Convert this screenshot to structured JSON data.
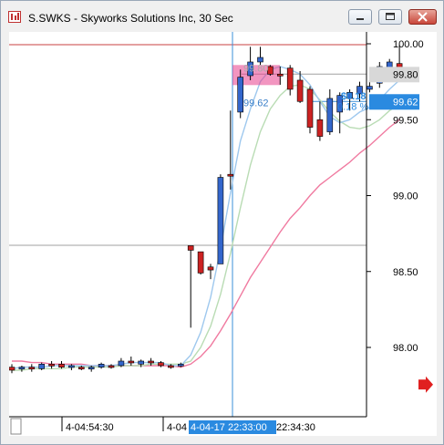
{
  "window": {
    "title": "S.SWKS - Skyworks Solutions Inc, 30 Sec",
    "minimize_icon": "minimize-icon",
    "maximize_icon": "maximize-icon",
    "close_icon": "close-icon"
  },
  "chart_data": {
    "type": "candlestick",
    "symbol": "S.SWKS",
    "y_ticks": [
      "100.00",
      "99.50",
      "99.00",
      "98.50",
      "98.00"
    ],
    "y_tick_values": [
      100.0,
      99.5,
      99.0,
      98.5,
      98.0
    ],
    "ylim": [
      97.55,
      100.07
    ],
    "x_labels": [
      "4-04:54:30",
      "4-04",
      "4-04-17 22:33:00",
      "22:34:30"
    ],
    "last_price_label": "99.80",
    "current_price_label": "99.62",
    "measure": {
      "start_label": "99.80",
      "end_label": "99.62",
      "change_label": "$0.18",
      "change_pct_label": "0.18 %"
    },
    "crosshair_time": "4-04-17 22:33:00",
    "colors": {
      "up": "#3366cc",
      "down": "#cc2222",
      "highlight": "#e83e8c",
      "ma_blue": "#9ec8ee",
      "ma_green": "#b9dcb4",
      "ma_pink": "#f07aa0",
      "resistance": "#c84040"
    },
    "candles": [
      {
        "o": 97.87,
        "h": 97.89,
        "l": 97.83,
        "c": 97.85
      },
      {
        "o": 97.86,
        "h": 97.88,
        "l": 97.84,
        "c": 97.87
      },
      {
        "o": 97.87,
        "h": 97.89,
        "l": 97.84,
        "c": 97.86
      },
      {
        "o": 97.86,
        "h": 97.9,
        "l": 97.85,
        "c": 97.89
      },
      {
        "o": 97.89,
        "h": 97.91,
        "l": 97.86,
        "c": 97.88
      },
      {
        "o": 97.89,
        "h": 97.91,
        "l": 97.86,
        "c": 97.87
      },
      {
        "o": 97.87,
        "h": 97.89,
        "l": 97.85,
        "c": 97.88
      },
      {
        "o": 97.87,
        "h": 97.88,
        "l": 97.85,
        "c": 97.86
      },
      {
        "o": 97.86,
        "h": 97.88,
        "l": 97.84,
        "c": 97.87
      },
      {
        "o": 97.87,
        "h": 97.9,
        "l": 97.86,
        "c": 97.89
      },
      {
        "o": 97.88,
        "h": 97.89,
        "l": 97.86,
        "c": 97.87
      },
      {
        "o": 97.88,
        "h": 97.93,
        "l": 97.87,
        "c": 97.91
      },
      {
        "o": 97.91,
        "h": 97.94,
        "l": 97.88,
        "c": 97.9
      },
      {
        "o": 97.89,
        "h": 97.92,
        "l": 97.87,
        "c": 97.91
      },
      {
        "o": 97.91,
        "h": 97.93,
        "l": 97.88,
        "c": 97.9
      },
      {
        "o": 97.9,
        "h": 97.91,
        "l": 97.87,
        "c": 97.88
      },
      {
        "o": 97.88,
        "h": 97.89,
        "l": 97.86,
        "c": 97.87
      },
      {
        "o": 97.88,
        "h": 97.9,
        "l": 97.87,
        "c": 97.89
      },
      {
        "o": 98.67,
        "h": 98.67,
        "l": 98.13,
        "c": 98.64
      },
      {
        "o": 98.63,
        "h": 98.63,
        "l": 98.48,
        "c": 98.49
      },
      {
        "o": 98.53,
        "h": 98.55,
        "l": 98.45,
        "c": 98.51
      },
      {
        "o": 98.55,
        "h": 99.14,
        "l": 98.55,
        "c": 99.12
      },
      {
        "o": 99.14,
        "h": 99.56,
        "l": 99.04,
        "c": 99.13
      },
      {
        "o": 99.55,
        "h": 99.83,
        "l": 99.51,
        "c": 99.78
      },
      {
        "o": 99.79,
        "h": 99.98,
        "l": 99.76,
        "c": 99.88
      },
      {
        "o": 99.88,
        "h": 99.98,
        "l": 99.86,
        "c": 99.91
      },
      {
        "o": 99.85,
        "h": 99.86,
        "l": 99.79,
        "c": 99.8
      },
      {
        "o": 99.8,
        "h": 99.85,
        "l": 99.73,
        "c": 99.79
      },
      {
        "o": 99.84,
        "h": 99.86,
        "l": 99.66,
        "c": 99.7
      },
      {
        "o": 99.76,
        "h": 99.82,
        "l": 99.61,
        "c": 99.62
      },
      {
        "o": 99.7,
        "h": 99.72,
        "l": 99.41,
        "c": 99.45
      },
      {
        "o": 99.5,
        "h": 99.62,
        "l": 99.36,
        "c": 99.39
      },
      {
        "o": 99.42,
        "h": 99.7,
        "l": 99.4,
        "c": 99.64
      },
      {
        "o": 99.55,
        "h": 99.68,
        "l": 99.41,
        "c": 99.66
      },
      {
        "o": 99.64,
        "h": 99.7,
        "l": 99.56,
        "c": 99.68
      },
      {
        "o": 99.67,
        "h": 99.75,
        "l": 99.62,
        "c": 99.72
      },
      {
        "o": 99.7,
        "h": 99.76,
        "l": 99.68,
        "c": 99.72
      },
      {
        "o": 99.74,
        "h": 99.88,
        "l": 99.71,
        "c": 99.85
      },
      {
        "o": 99.83,
        "h": 99.9,
        "l": 99.79,
        "c": 99.88
      },
      {
        "o": 99.87,
        "h": 99.99,
        "l": 99.75,
        "c": 99.83
      }
    ],
    "ma_blue": [
      97.86,
      97.87,
      97.87,
      97.87,
      97.88,
      97.88,
      97.88,
      97.88,
      97.88,
      97.88,
      97.88,
      97.89,
      97.9,
      97.9,
      97.9,
      97.9,
      97.88,
      97.88,
      97.95,
      98.1,
      98.33,
      98.65,
      99.02,
      99.36,
      99.57,
      99.75,
      99.83,
      99.85,
      99.83,
      99.8,
      99.73,
      99.62,
      99.52,
      99.48,
      99.5,
      99.55,
      99.58,
      99.63,
      99.7,
      99.76
    ],
    "ma_green": [
      97.85,
      97.85,
      97.86,
      97.86,
      97.86,
      97.86,
      97.87,
      97.87,
      97.87,
      97.87,
      97.87,
      97.88,
      97.88,
      97.88,
      97.89,
      97.89,
      97.89,
      97.89,
      97.91,
      98.0,
      98.14,
      98.35,
      98.62,
      98.92,
      99.2,
      99.42,
      99.57,
      99.66,
      99.72,
      99.73,
      99.7,
      99.63,
      99.55,
      99.49,
      99.45,
      99.44,
      99.46,
      99.5,
      99.56,
      99.6
    ],
    "ma_pink": [
      97.91,
      97.91,
      97.9,
      97.9,
      97.89,
      97.89,
      97.89,
      97.89,
      97.88,
      97.88,
      97.88,
      97.88,
      97.88,
      97.88,
      97.88,
      97.88,
      97.88,
      97.87,
      97.89,
      97.94,
      98.01,
      98.11,
      98.22,
      98.34,
      98.46,
      98.56,
      98.66,
      98.76,
      98.85,
      98.92,
      99.0,
      99.07,
      99.12,
      99.17,
      99.22,
      99.28,
      99.33,
      99.39,
      99.45,
      99.5
    ]
  }
}
